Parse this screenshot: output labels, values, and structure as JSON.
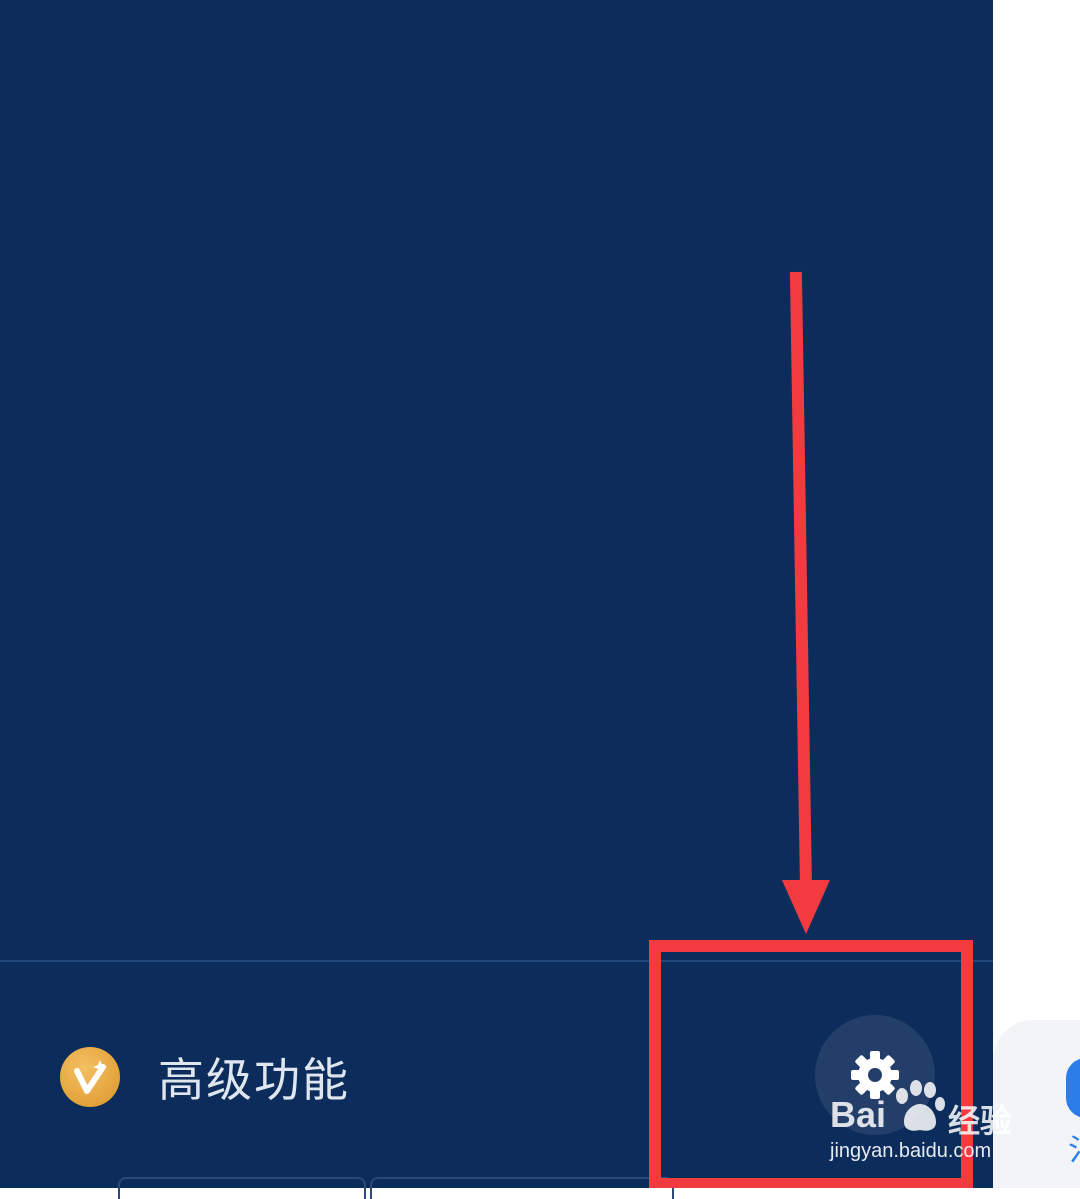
{
  "drawer": {
    "background": "#0c2d5b",
    "advanced_feature": {
      "icon": "vip-badge-icon",
      "label": "高级功能"
    },
    "settings_button": {
      "icon": "gear-icon"
    }
  },
  "right_panel": {
    "partial_glyph": "氵"
  },
  "annotation": {
    "color": "#f23b3f",
    "arrow": "pointing down to settings",
    "box": "highlight around settings button"
  },
  "watermark": {
    "brand": "Bai",
    "brand_cn": "经验",
    "domain": "jingyan.baidu.com"
  }
}
